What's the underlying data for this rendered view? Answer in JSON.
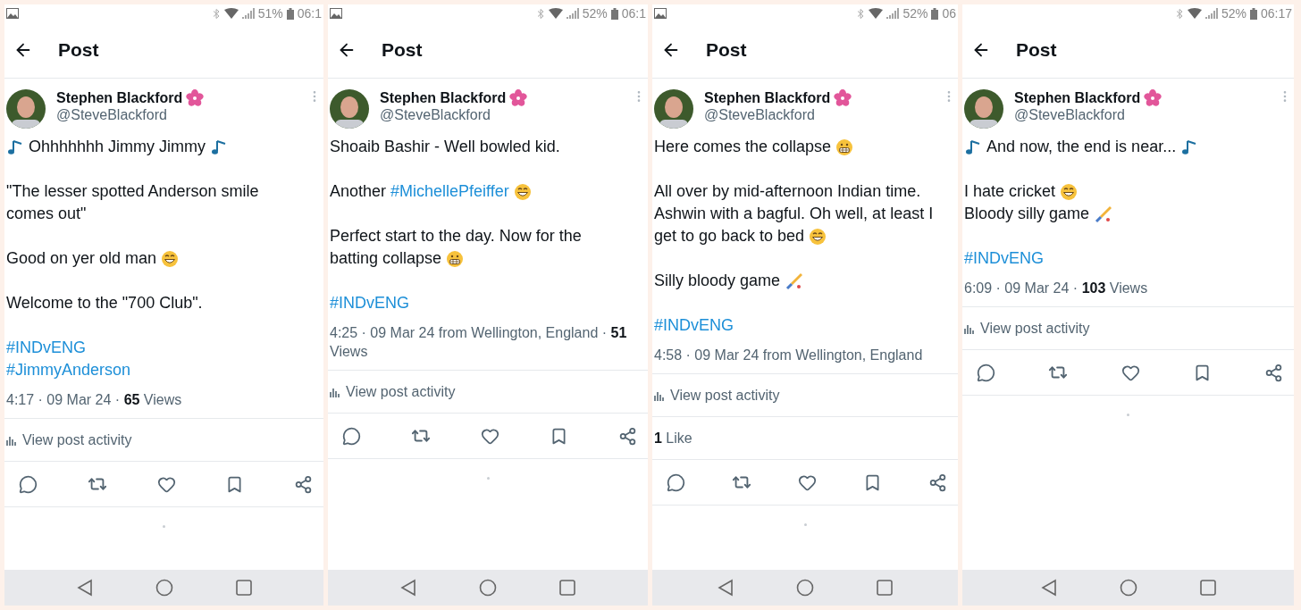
{
  "panels": [
    {
      "status": {
        "gallery_notification": true,
        "battery": "51%",
        "time": "06:1"
      },
      "header": {
        "title": "Post"
      },
      "author": {
        "name": "Stephen Blackford",
        "handle": "@SteveBlackford"
      },
      "body": [
        [
          [
            {
              "kind": "note"
            },
            {
              "kind": "text",
              "text": "Ohhhhhhh Jimmy Jimmy"
            },
            {
              "kind": "note"
            }
          ]
        ],
        [
          [
            {
              "kind": "text",
              "text": "\"The lesser spotted Anderson smile"
            }
          ],
          [
            {
              "kind": "text",
              "text": "comes out\""
            }
          ]
        ],
        [
          [
            {
              "kind": "text",
              "text": "Good on yer old man"
            },
            {
              "kind": "grin"
            }
          ]
        ],
        [
          [
            {
              "kind": "text",
              "text": "Welcome to the \"700 Club\"."
            }
          ]
        ],
        [
          [
            {
              "kind": "hashtag",
              "text": "#INDvENG"
            }
          ],
          [
            {
              "kind": "hashtag",
              "text": "#JimmyAnderson"
            }
          ]
        ]
      ],
      "meta": "4:17 · 09 Mar 24 · **65** Views",
      "activity": "View post activity"
    },
    {
      "status": {
        "gallery_notification": true,
        "battery": "52%",
        "time": "06:1"
      },
      "header": {
        "title": "Post"
      },
      "author": {
        "name": "Stephen Blackford",
        "handle": "@SteveBlackford"
      },
      "body": [
        [
          [
            {
              "kind": "text",
              "text": "Shoaib Bashir - Well bowled kid."
            }
          ]
        ],
        [
          [
            {
              "kind": "text",
              "text": "Another"
            },
            {
              "kind": "hashtag",
              "text": "#MichellePfeiffer"
            },
            {
              "kind": "grin"
            }
          ]
        ],
        [
          [
            {
              "kind": "text",
              "text": "Perfect start to the day. Now for the"
            }
          ],
          [
            {
              "kind": "text",
              "text": "batting collapse"
            },
            {
              "kind": "grimace"
            }
          ]
        ],
        [
          [
            {
              "kind": "hashtag",
              "text": "#INDvENG"
            }
          ]
        ]
      ],
      "meta": "4:25 · 09 Mar 24 from Wellington, England · **51** Views",
      "activity": "View post activity"
    },
    {
      "status": {
        "gallery_notification": true,
        "battery": "52%",
        "time": "06"
      },
      "header": {
        "title": "Post"
      },
      "author": {
        "name": "Stephen Blackford",
        "handle": "@SteveBlackford"
      },
      "body": [
        [
          [
            {
              "kind": "text",
              "text": "Here comes the collapse"
            },
            {
              "kind": "grimace"
            }
          ]
        ],
        [
          [
            {
              "kind": "text",
              "text": "All over by mid-afternoon Indian time."
            }
          ],
          [
            {
              "kind": "text",
              "text": "Ashwin with a bagful. Oh well, at least I"
            }
          ],
          [
            {
              "kind": "text",
              "text": "get to go back to bed"
            },
            {
              "kind": "grin"
            }
          ]
        ],
        [
          [
            {
              "kind": "text",
              "text": "Silly bloody game"
            },
            {
              "kind": "bat"
            }
          ]
        ],
        [
          [
            {
              "kind": "hashtag",
              "text": "#INDvENG"
            }
          ]
        ]
      ],
      "meta": "4:58 · 09 Mar 24 from Wellington, England",
      "activity": "View post activity",
      "likes": "**1** Like"
    },
    {
      "status": {
        "gallery_notification": false,
        "battery": "52%",
        "time": "06:17"
      },
      "header": {
        "title": "Post"
      },
      "author": {
        "name": "Stephen Blackford",
        "handle": "@SteveBlackford"
      },
      "body": [
        [
          [
            {
              "kind": "note"
            },
            {
              "kind": "text",
              "text": "And now, the end is near..."
            },
            {
              "kind": "note"
            }
          ]
        ],
        [
          [
            {
              "kind": "text",
              "text": "I hate cricket"
            },
            {
              "kind": "grin"
            }
          ],
          [
            {
              "kind": "text",
              "text": "Bloody silly game"
            },
            {
              "kind": "bat"
            }
          ]
        ],
        [
          [
            {
              "kind": "hashtag",
              "text": "#INDvENG"
            }
          ]
        ]
      ],
      "meta": "6:09 · 09 Mar 24 · **103** Views",
      "activity": "View post activity"
    }
  ]
}
